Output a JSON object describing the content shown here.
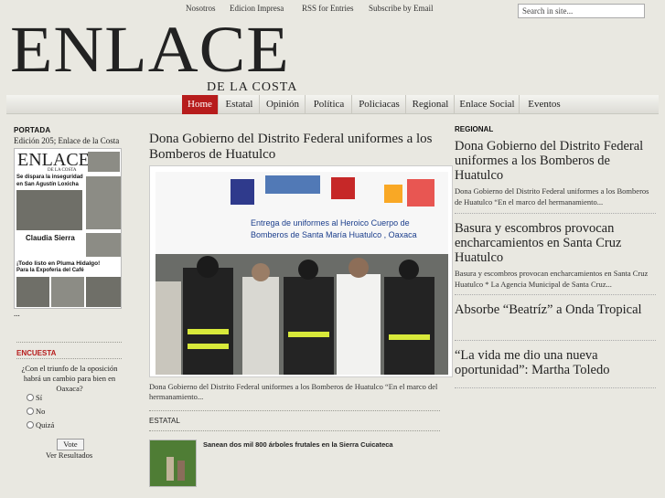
{
  "top_nav": {
    "links": [
      "Nosotros",
      "Edicion Impresa",
      "RSS for Entries",
      "Subscribe by Email"
    ],
    "search_placeholder": "Search in site..."
  },
  "logo": {
    "main": "ENLACE",
    "sub": "DE LA COSTA"
  },
  "main_nav": {
    "items": [
      "Home",
      "Estatal",
      "Opinión",
      "Política",
      "Policiacas",
      "Regional",
      "Enlace Social",
      "Eventos"
    ],
    "active": "Home"
  },
  "portada": {
    "heading": "PORTADA",
    "edition": "Edición 205; Enlace de la Costa",
    "cover_head": "ENLACE",
    "cover_sub": "DE LA COSTA",
    "cover_lines": [
      "Se dispara la inseguridad",
      "en San Agustín Loxicha",
      "Claudia Sierra",
      "¡Todo listo en Pluma Hidalgo!",
      "Para la Expoferia del Café"
    ],
    "ellipsis": "..."
  },
  "encuesta": {
    "heading": "ENCUESTA",
    "question": "¿Con el triunfo de la oposición habrá un cambio para bien en Oaxaca?",
    "options": [
      "Sí",
      "No",
      "Quizá"
    ],
    "vote_label": "Vote",
    "results_label": "Ver Resultados"
  },
  "featured": {
    "title": "Dona Gobierno del Distrito Federal uniformes a los Bomberos de Huatulco",
    "banner_text": "Entrega de uniformes al Heroico Cuerpo de Bomberos de Santa María Huatulco , Oaxaca",
    "caption": "Dona Gobierno del Distrito Federal uniformes a los Bomberos de Huatulco “En el marco del hermanamiento..."
  },
  "estatal": {
    "heading": "ESTATAL",
    "article_title": "Sanean dos mil 800 árboles frutales en la Sierra Cuicateca"
  },
  "regional": {
    "heading": "REGIONAL",
    "articles": [
      {
        "title": "Dona Gobierno del Distrito Federal uniformes a los Bomberos de Huatulco",
        "excerpt": "Dona Gobierno del Distrito Federal uniformes a los Bomberos de Huatulco “En el marco del hermanamiento..."
      },
      {
        "title": "Basura y escombros provocan encharcamientos en Santa Cruz Huatulco",
        "excerpt": "Basura y escombros provocan encharcamientos en Santa Cruz Huatulco * La Agencia Municipal de Santa Cruz..."
      },
      {
        "title": "Absorbe “Beatríz” a Onda Tropical",
        "excerpt": ""
      },
      {
        "title": "“La vida me dio una nueva oportunidad”: Martha Toledo",
        "excerpt": ""
      }
    ]
  },
  "colors": {
    "accent": "#b71c1c",
    "background": "#e9e8e1",
    "banner_blue": "#1b3e8c"
  }
}
